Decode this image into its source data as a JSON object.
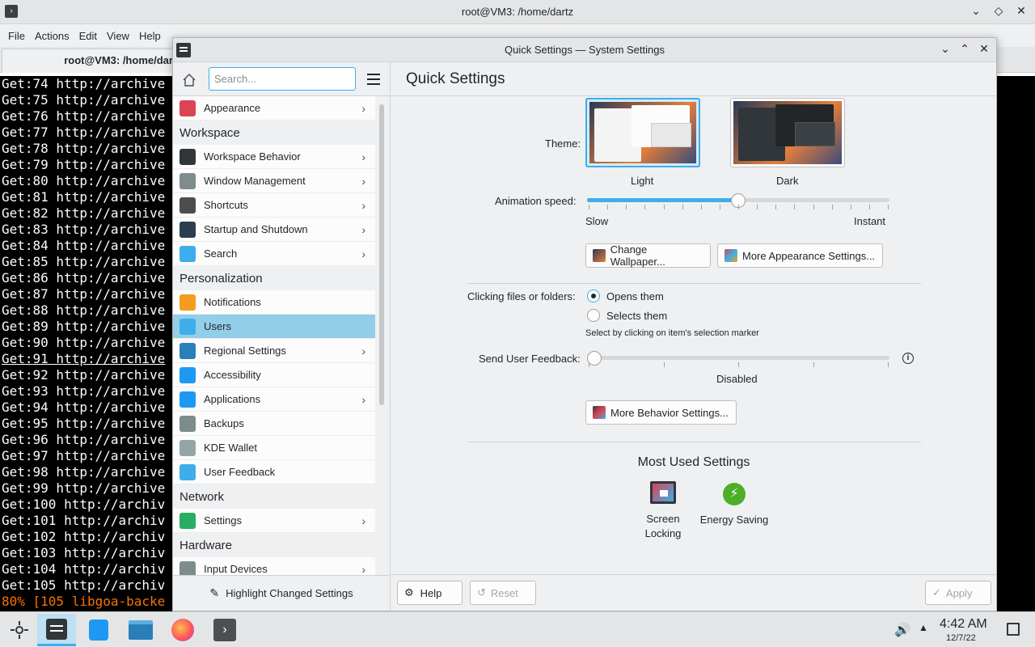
{
  "terminal": {
    "window_title": "root@VM3: /home/dartz",
    "menu": [
      "File",
      "Actions",
      "Edit",
      "View",
      "Help"
    ],
    "tab_title": "root@VM3: /home/dartz",
    "lines": [
      "Get:74 http://archive",
      "Get:75 http://archive",
      "Get:76 http://archive",
      "Get:77 http://archive",
      "Get:78 http://archive",
      "Get:79 http://archive",
      "Get:80 http://archive",
      "Get:81 http://archive",
      "Get:82 http://archive",
      "Get:83 http://archive",
      "Get:84 http://archive",
      "Get:85 http://archive",
      "Get:86 http://archive",
      "Get:87 http://archive",
      "Get:88 http://archive",
      "Get:89 http://archive",
      "Get:90 http://archive",
      "Get:91 http://archive",
      "Get:92 http://archive",
      "Get:93 http://archive",
      "Get:94 http://archive",
      "Get:95 http://archive",
      "Get:96 http://archive",
      "Get:97 http://archive",
      "Get:98 http://archive",
      "Get:99 http://archive",
      "Get:100 http://archiv",
      "Get:101 http://archiv",
      "Get:102 http://archiv",
      "Get:103 http://archiv",
      "Get:104 http://archiv",
      "Get:105 http://archiv"
    ],
    "progress_line": "80% [105 libgoa-backe"
  },
  "settings": {
    "window_title": "Quick Settings — System Settings",
    "search_placeholder": "Search...",
    "sidebar": {
      "entries": [
        {
          "kind": "item",
          "label": "Appearance",
          "icon": "appearance-icon",
          "chevron": true,
          "color": "#da4453"
        },
        {
          "kind": "header",
          "label": "Workspace"
        },
        {
          "kind": "item",
          "label": "Workspace Behavior",
          "icon": "workspace-behavior-icon",
          "chevron": true,
          "color": "#31363b"
        },
        {
          "kind": "item",
          "label": "Window Management",
          "icon": "window-management-icon",
          "chevron": true,
          "color": "#7f8c8d"
        },
        {
          "kind": "item",
          "label": "Shortcuts",
          "icon": "keyboard-icon",
          "chevron": true,
          "color": "#4d4d4d"
        },
        {
          "kind": "item",
          "label": "Startup and Shutdown",
          "icon": "startup-icon",
          "chevron": true,
          "color": "#2c3e50"
        },
        {
          "kind": "item",
          "label": "Search",
          "icon": "search-icon",
          "chevron": true,
          "color": "#3daee9"
        },
        {
          "kind": "header",
          "label": "Personalization"
        },
        {
          "kind": "item",
          "label": "Notifications",
          "icon": "bell-icon",
          "chevron": false,
          "color": "#f39c1f"
        },
        {
          "kind": "item",
          "label": "Users",
          "icon": "users-icon",
          "chevron": false,
          "color": "#3daee9",
          "selected": true
        },
        {
          "kind": "item",
          "label": "Regional Settings",
          "icon": "regional-icon",
          "chevron": true,
          "color": "#2980b9"
        },
        {
          "kind": "item",
          "label": "Accessibility",
          "icon": "accessibility-icon",
          "chevron": false,
          "color": "#1d99f3"
        },
        {
          "kind": "item",
          "label": "Applications",
          "icon": "applications-icon",
          "chevron": true,
          "color": "#1d99f3"
        },
        {
          "kind": "item",
          "label": "Backups",
          "icon": "backups-icon",
          "chevron": false,
          "color": "#7f8c8d"
        },
        {
          "kind": "item",
          "label": "KDE Wallet",
          "icon": "wallet-icon",
          "chevron": false,
          "color": "#95a5a6"
        },
        {
          "kind": "item",
          "label": "User Feedback",
          "icon": "feedback-icon",
          "chevron": false,
          "color": "#3daee9"
        },
        {
          "kind": "header",
          "label": "Network"
        },
        {
          "kind": "item",
          "label": "Settings",
          "icon": "globe-icon",
          "chevron": true,
          "color": "#27ae60"
        },
        {
          "kind": "header",
          "label": "Hardware"
        },
        {
          "kind": "item",
          "label": "Input Devices",
          "icon": "input-devices-icon",
          "chevron": true,
          "color": "#7f8c8d"
        }
      ],
      "highlight_label": "Highlight Changed Settings"
    },
    "main": {
      "title": "Quick Settings",
      "theme_label": "Theme:",
      "theme_light": "Light",
      "theme_dark": "Dark",
      "animation_label": "Animation speed:",
      "animation_value": 0.5,
      "slow_label": "Slow",
      "instant_label": "Instant",
      "change_wallpaper": "Change Wallpaper...",
      "more_appearance": "More Appearance Settings...",
      "clicking_label": "Clicking files or folders:",
      "opens_them": "Opens them",
      "selects_them": "Selects them",
      "selects_hint": "Select by clicking on item's selection marker",
      "feedback_label": "Send User Feedback:",
      "feedback_value": 0,
      "feedback_state": "Disabled",
      "more_behavior": "More Behavior Settings...",
      "most_used_title": "Most Used Settings",
      "most_used": [
        {
          "label": "Screen\nLocking",
          "icon": "screen-locking-icon"
        },
        {
          "label": "Energy Saving",
          "icon": "energy-saving-icon"
        }
      ]
    },
    "footer": {
      "help": "Help",
      "reset": "Reset",
      "apply": "Apply"
    }
  },
  "taskbar": {
    "time": "4:42 AM",
    "date": "12/7/22"
  },
  "colors": {
    "accent": "#3daee9",
    "selection": "#93cee9"
  }
}
